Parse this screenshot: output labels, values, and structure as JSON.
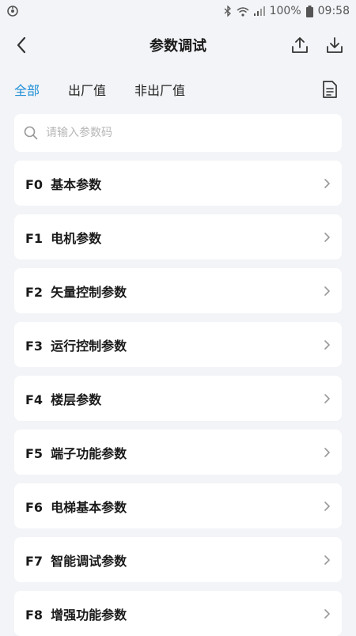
{
  "status_bar": {
    "battery": "100%",
    "time": "09:58"
  },
  "header": {
    "title": "参数调试",
    "back_icon": "back-arrow-icon",
    "upload_icon": "upload-icon",
    "download_icon": "download-icon"
  },
  "tabs": [
    {
      "label": "全部",
      "active": true
    },
    {
      "label": "出厂值",
      "active": false
    },
    {
      "label": "非出厂值",
      "active": false
    }
  ],
  "search": {
    "placeholder": "请输入参数码",
    "value": ""
  },
  "groups": [
    {
      "code": "F0",
      "name": "基本参数"
    },
    {
      "code": "F1",
      "name": "电机参数"
    },
    {
      "code": "F2",
      "name": "矢量控制参数"
    },
    {
      "code": "F3",
      "name": "运行控制参数"
    },
    {
      "code": "F4",
      "name": "楼层参数"
    },
    {
      "code": "F5",
      "name": "端子功能参数"
    },
    {
      "code": "F6",
      "name": "电梯基本参数"
    },
    {
      "code": "F7",
      "name": "智能调试参数"
    },
    {
      "code": "F8",
      "name": "增强功能参数"
    }
  ],
  "colors": {
    "accent": "#1f8fd6",
    "background": "#f3f4f7",
    "card": "#ffffff"
  }
}
